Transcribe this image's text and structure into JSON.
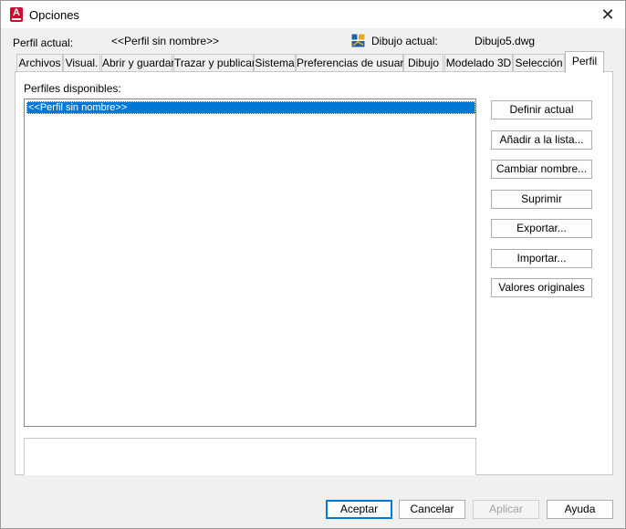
{
  "window": {
    "title": "Opciones",
    "close_symbol": "✕"
  },
  "header": {
    "current_profile_label": "Perfil actual:",
    "current_profile_value": "<<Perfil sin nombre>>",
    "current_drawing_label": "Dibujo actual:",
    "current_drawing_value": "Dibujo5.dwg",
    "drawing_icon": "drawing-file-icon"
  },
  "tabs": [
    {
      "label": "Archivos"
    },
    {
      "label": "Visual."
    },
    {
      "label": "Abrir y guardar"
    },
    {
      "label": "Trazar y publicar"
    },
    {
      "label": "Sistema"
    },
    {
      "label": "Preferencias de usuario"
    },
    {
      "label": "Dibujo"
    },
    {
      "label": "Modelado 3D"
    },
    {
      "label": "Selección"
    },
    {
      "label": "Perfil",
      "active": true
    }
  ],
  "profiles": {
    "label": "Perfiles disponibles:",
    "items": [
      {
        "name": "<<Perfil sin nombre>>",
        "selected": true
      }
    ],
    "description": ""
  },
  "side_buttons": {
    "set_current": "Definir actual",
    "add_to_list": "Añadir a la lista...",
    "rename": "Cambiar nombre...",
    "delete": "Suprimir",
    "export": "Exportar...",
    "import": "Importar...",
    "reset": "Valores originales"
  },
  "bottom_buttons": {
    "ok": "Aceptar",
    "cancel": "Cancelar",
    "apply": "Aplicar",
    "help": "Ayuda"
  },
  "colors": {
    "selection": "#0078d7",
    "brand": "#c8102e"
  }
}
